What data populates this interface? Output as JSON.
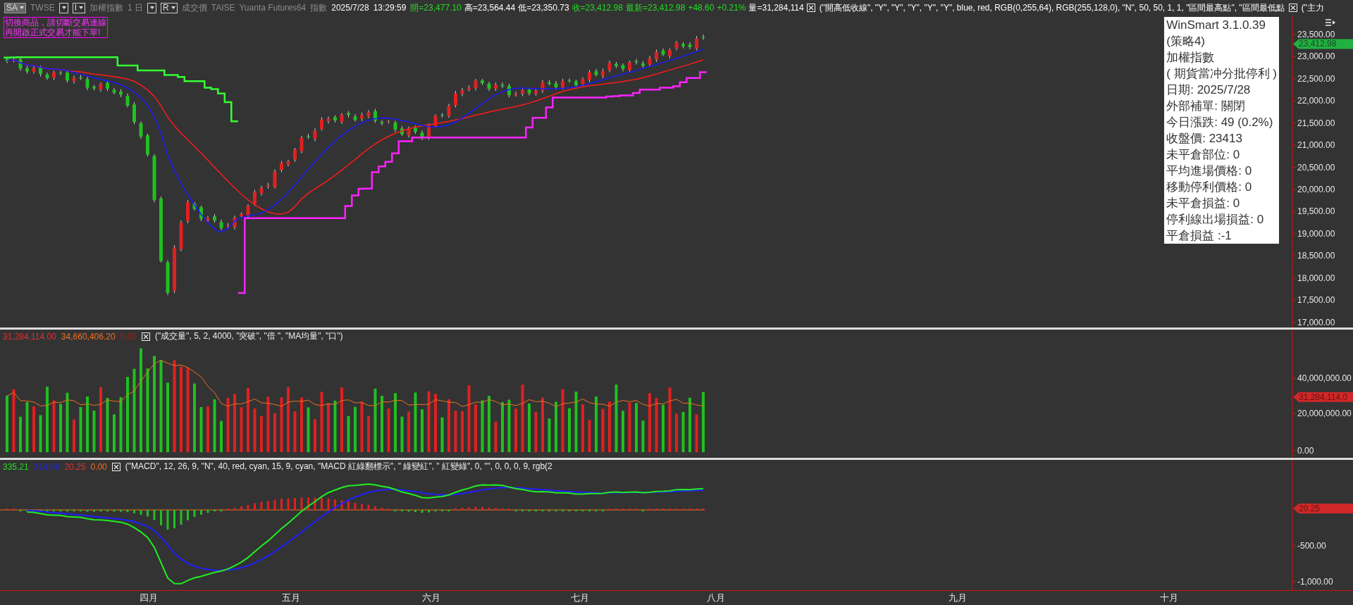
{
  "toolbar": {
    "items": [
      {
        "kind": "dropdown",
        "text": "SA"
      },
      {
        "kind": "label",
        "text": "TWSE"
      },
      {
        "kind": "dropdown"
      },
      {
        "kind": "dropdown",
        "text": "I"
      },
      {
        "kind": "label",
        "text": "加權指數"
      },
      {
        "kind": "label",
        "text": "1 日"
      },
      {
        "kind": "dropdown"
      },
      {
        "kind": "dropdown",
        "text": "R"
      },
      {
        "kind": "label",
        "text": "成交價"
      },
      {
        "kind": "label",
        "text": "TAISE"
      },
      {
        "kind": "label",
        "text": "Yuanta Futures64"
      },
      {
        "kind": "label",
        "text": "指數"
      },
      {
        "kind": "value",
        "text": "2025/7/28"
      },
      {
        "kind": "value",
        "text": "13:29:59"
      }
    ],
    "quotes": [
      {
        "text": "開=23,477.10",
        "color": "#22dd22"
      },
      {
        "text": "高=23,564.44",
        "color": "#ffffff"
      },
      {
        "text": "低=23,350.73",
        "color": "#ffffff"
      },
      {
        "text": "收=23,412.98",
        "color": "#22dd22"
      },
      {
        "text": "最新=23,412.98",
        "color": "#22dd22"
      },
      {
        "text": "+48.60",
        "color": "#22dd22"
      },
      {
        "text": "+0.21%",
        "color": "#22dd22"
      },
      {
        "text": "量=31,284,114",
        "color": "#ffffff"
      }
    ],
    "studies": [
      {
        "text": "(\"開高低收線\", \"Y\", \"Y\", \"Y\", \"Y\", \"Y\", blue, red, RGB(0,255,64), RGB(255,128,0), \"N\", 50, 50, 1, 1, \"區間最高點\", \"區間最低點"
      },
      {
        "text": "(\"主力"
      }
    ]
  },
  "warning": {
    "lines": [
      "切換商品，請切斷交易連線",
      "再開啟正式交易才能下單!"
    ]
  },
  "price_panel": {
    "yticks": [
      "23,500.00",
      "23,000.00",
      "22,500.00",
      "22,000.00",
      "21,500.00",
      "21,000.00",
      "20,500.00",
      "20,000.00",
      "19,500.00",
      "19,000.00",
      "18,500.00",
      "18,000.00",
      "17,500.00",
      "17,000.00"
    ],
    "last_price_tag": "23,412.98"
  },
  "info_box": {
    "lines": [
      "WinSmart 3.1.0.39",
      "(策略4)",
      "加權指數",
      "( 期貨當冲分批停利 )",
      "日期: 2025/7/28",
      "外部補單: 關閉",
      "今日漲跌: 49 (0.2%)",
      "收盤價: 23413",
      "未平倉部位: 0",
      "平均進場價格: 0",
      "移動停利價格: 0",
      "未平倉損益: 0",
      "停利線出場損益: 0",
      "平倉損益 :-1"
    ]
  },
  "volume_panel": {
    "header_values": [
      {
        "text": "31,284,114.00",
        "color": "#e03030"
      },
      {
        "text": "34,660,406.20",
        "color": "#f07020"
      },
      {
        "text": "0.00",
        "color": "#a02010"
      }
    ],
    "study": "(\"成交量\", 5, 2, 4000, \"突破\", \"倍 \", \"MA均量\", \"口\")",
    "yticks": [
      "40,000,000.00",
      "20,000,000.00",
      "0.00"
    ],
    "last_value_tag": "31,284,114.0"
  },
  "macd_panel": {
    "header_values": [
      {
        "text": "335.21",
        "color": "#22dd22"
      },
      {
        "text": "314.96",
        "color": "#2020e0"
      },
      {
        "text": "20.25",
        "color": "#e03030"
      },
      {
        "text": "0.00",
        "color": "#f07020"
      }
    ],
    "study": "(\"MACD\", 12, 26, 9, \"N\", 40, red, cyan, 15, 9, cyan, \"MACD 紅綠翻標示\", \" 綠變紅\", \" 紅變綠\", 0, \"\", 0, 0, 0, 9, rgb(2",
    "yticks": [
      "-500.00",
      "-1,000.00"
    ],
    "last_value_tag": "20.25"
  },
  "x_axis": {
    "labels": [
      "四月",
      "五月",
      "六月",
      "七月",
      "八月",
      "九月",
      "十月"
    ]
  }
}
